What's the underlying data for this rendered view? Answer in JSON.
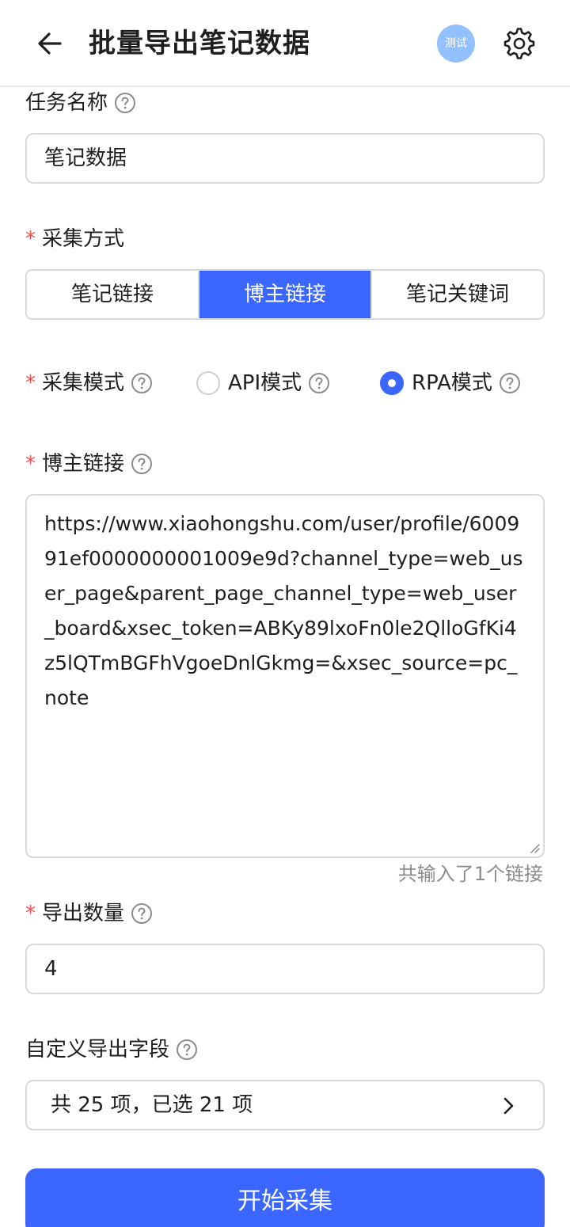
{
  "header": {
    "title": "批量导出笔记数据",
    "avatar_text": "测试",
    "back_icon": "arrow-left-icon",
    "settings_icon": "gear-icon"
  },
  "task_name": {
    "label": "任务名称",
    "value": "笔记数据"
  },
  "collect_method": {
    "label": "采集方式",
    "options": [
      "笔记链接",
      "博主链接",
      "笔记关键词"
    ],
    "selected": "博主链接"
  },
  "collect_mode": {
    "label": "采集模式",
    "options": [
      {
        "label": "API模式",
        "checked": false
      },
      {
        "label": "RPA模式",
        "checked": true
      }
    ]
  },
  "blogger_link": {
    "label": "博主链接",
    "value": "https://www.xiaohongshu.com/user/profile/600991ef0000000001009e9d?channel_type=web_user_page&parent_page_channel_type=web_user_board&xsec_token=ABKy89lxoFn0le2QlloGfKi4z5lQTmBGFhVgoeDnlGkmg=&xsec_source=pc_note",
    "hint": "共输入了1个链接"
  },
  "export_count": {
    "label": "导出数量",
    "value": "4"
  },
  "custom_fields": {
    "label": "自定义导出字段",
    "summary": "共 25 项，已选 21 项"
  },
  "submit": {
    "label": "开始采集"
  },
  "colors": {
    "primary": "#3b66ff",
    "required": "#ff4d4f",
    "avatar": "#93c1ff"
  }
}
